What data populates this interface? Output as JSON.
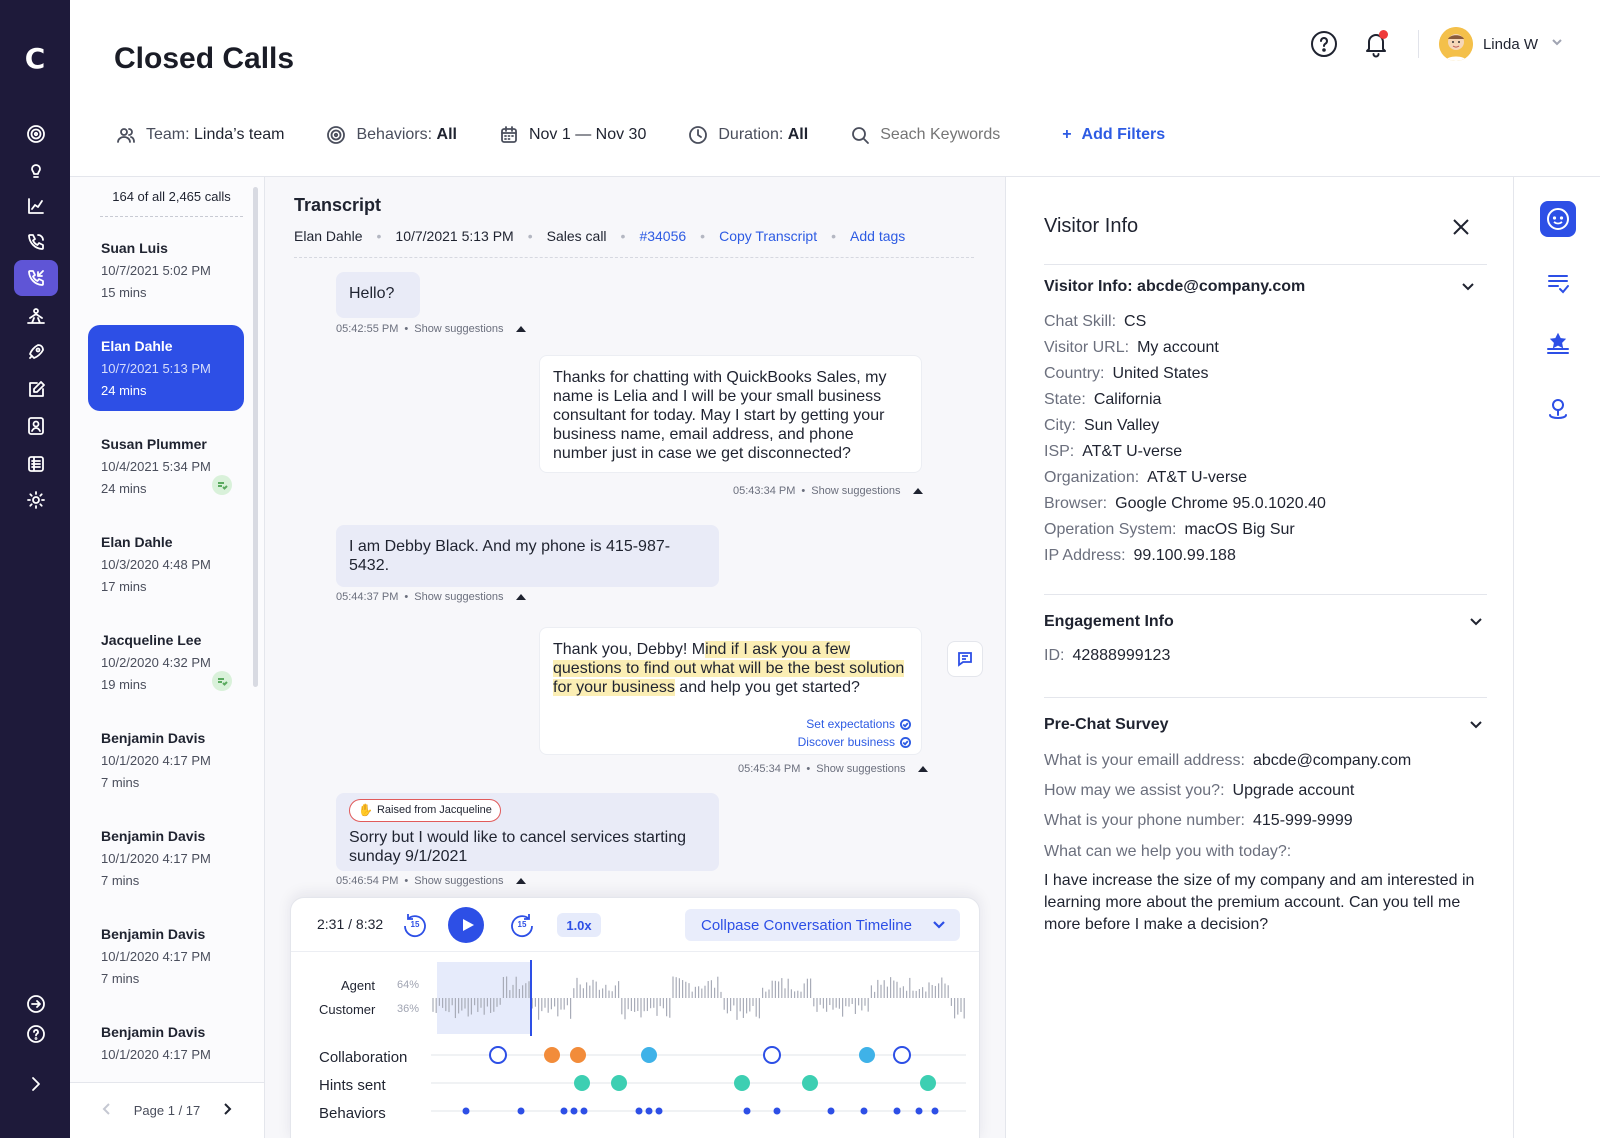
{
  "app": {
    "logo": "C"
  },
  "page": {
    "title": "Closed Calls"
  },
  "header": {
    "user_name": "Linda W"
  },
  "filters": {
    "team_label": "Team:",
    "team_value": "Linda’s team",
    "behaviors_label": "Behaviors:",
    "behaviors_value": "All",
    "date_range": "Nov 1 — Nov 30",
    "duration_label": "Duration:",
    "duration_value": "All",
    "search_placeholder": "Seach Keywords",
    "add_filters": "Add Filters"
  },
  "call_list": {
    "count": "164 of all 2,465 calls",
    "items": [
      {
        "name": "Suan Luis",
        "date": "10/7/2021 5:02 PM",
        "duration": "15 mins"
      },
      {
        "name": "Elan Dahle",
        "date": "10/7/2021 5:13 PM",
        "duration": "24 mins"
      },
      {
        "name": "Susan Plummer",
        "date": "10/4/2021 5:34 PM",
        "duration": "24 mins"
      },
      {
        "name": "Elan Dahle",
        "date": "10/3/2020 4:48 PM",
        "duration": "17 mins"
      },
      {
        "name": "Jacqueline Lee",
        "date": "10/2/2020 4:32 PM",
        "duration": "19 mins"
      },
      {
        "name": "Benjamin Davis",
        "date": "10/1/2020 4:17 PM",
        "duration": "7 mins"
      },
      {
        "name": "Benjamin Davis",
        "date": "10/1/2020 4:17 PM",
        "duration": "7 mins"
      },
      {
        "name": "Benjamin Davis",
        "date": "10/1/2020 4:17 PM",
        "duration": "7 mins"
      },
      {
        "name": "Benjamin Davis",
        "date": "10/1/2020 4:17 PM",
        "duration": ""
      }
    ],
    "pager": "Page 1 / 17"
  },
  "transcript": {
    "title": "Transcript",
    "agent": "Elan Dahle",
    "datetime": "10/7/2021 5:13 PM",
    "type": "Sales call",
    "ticket": "#34056",
    "copy": "Copy Transcript",
    "add_tags": "Add tags",
    "show_suggestions": "Show suggestions",
    "messages": [
      {
        "text": "Hello?",
        "time": "05:42:55 PM"
      },
      {
        "text": "Thanks for chatting with QuickBooks Sales, my name is Lelia and I will be your small business consultant for today. May I start by getting your business name, email address, and phone number just in case we get disconnected?",
        "time": "05:43:34 PM"
      },
      {
        "text": "I am Debby Black. And my phone is 415-987-5432.",
        "time": "05:44:37 PM"
      },
      {
        "pre": "Thank you, Debby! M",
        "highlight": "ind if I ask you a few questions to find out what will be the best solution for your business",
        "post": " and help you get started?",
        "time": "05:45:34 PM",
        "tags": [
          "Set expectations",
          "Discover business"
        ]
      },
      {
        "raised": "Raised from Jacqueline",
        "text": "Sorry but I would like to cancel services starting sunday 9/1/2021",
        "time": "05:46:54 PM"
      }
    ]
  },
  "player": {
    "time": "2:31 / 8:32",
    "skip_back": "15",
    "skip_forward": "15",
    "speed": "1.0x",
    "collapse": "Collpase Conversation Timeline",
    "agent_label": "Agent",
    "agent_pct": "64%",
    "customer_label": "Customer",
    "customer_pct": "36%",
    "rows": [
      "Collaboration",
      "Hints sent",
      "Behaviors"
    ]
  },
  "visitor": {
    "title": "Visitor Info",
    "section1": "Visitor Info:  abcde@company.com",
    "fields": [
      {
        "k": "Chat Skill:",
        "v": "CS"
      },
      {
        "k": "Visitor URL:",
        "v": "My account"
      },
      {
        "k": "Country:",
        "v": "United States"
      },
      {
        "k": "State:",
        "v": "California"
      },
      {
        "k": "City:",
        "v": "Sun Valley"
      },
      {
        "k": "ISP:",
        "v": "AT&T U-verse"
      },
      {
        "k": "Organization:",
        "v": "AT&T U-verse"
      },
      {
        "k": "Browser:",
        "v": "Google Chrome 95.0.1020.40"
      },
      {
        "k": "Operation System:",
        "v": "macOS Big Sur"
      },
      {
        "k": "IP Address:",
        "v": "99.100.99.188"
      }
    ],
    "section2": "Engagement Info",
    "engagement_k": "ID:",
    "engagement_v": "42888999123",
    "section3": "Pre-Chat Survey",
    "survey": [
      {
        "k": "What is your emaill address:",
        "v": "abcde@company.com"
      },
      {
        "k": "How may we assist you?:",
        "v": "Upgrade account"
      },
      {
        "k": "What is your phone number:",
        "v": "415-999-9999"
      },
      {
        "k": "What can we help you with today?:",
        "v": ""
      }
    ],
    "survey_answer": "I have increase the size of my company and am interested in learning more about the premium account. Can you tell me more before I make a decision?"
  },
  "colors": {
    "nav_bg": "#1e1a3a",
    "accent": "#2d4fe6",
    "highlight": "#fbeeb4"
  }
}
